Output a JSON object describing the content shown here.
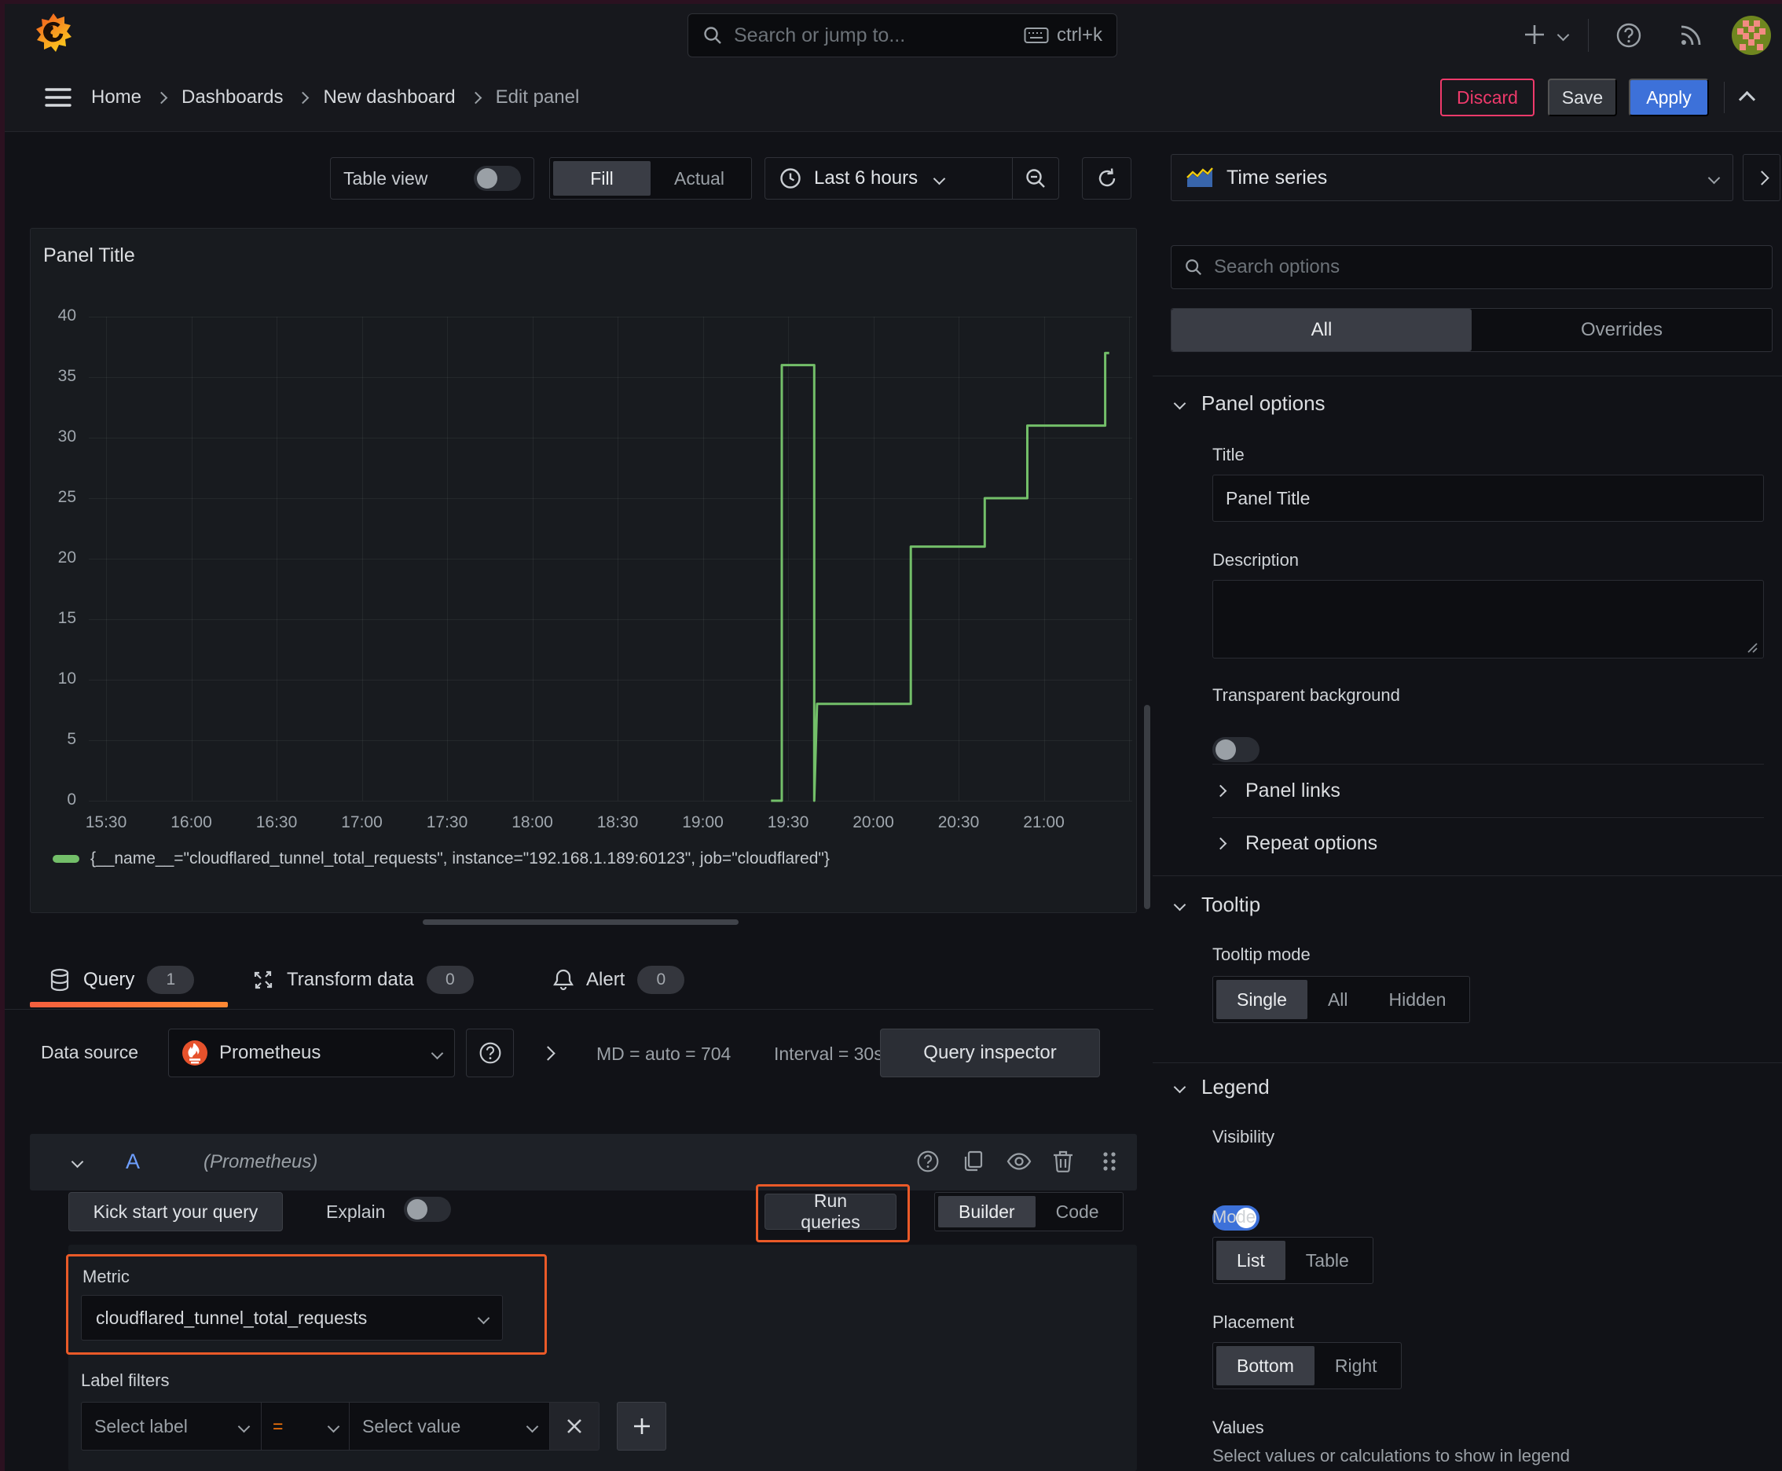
{
  "topnav": {
    "search_placeholder": "Search or jump to...",
    "shortcut": "ctrl+k"
  },
  "breadcrumb": {
    "items": [
      "Home",
      "Dashboards",
      "New dashboard",
      "Edit panel"
    ]
  },
  "actions": {
    "discard": "Discard",
    "save": "Save",
    "apply": "Apply"
  },
  "toolbar": {
    "table_view": "Table view",
    "fill": "Fill",
    "actual": "Actual",
    "time_range": "Last 6 hours"
  },
  "panel": {
    "title": "Panel Title"
  },
  "chart_data": {
    "type": "line",
    "line_style": "step",
    "title": "Panel Title",
    "grid": true,
    "legend_position": "bottom",
    "ylim": [
      0,
      40
    ],
    "y_ticks": [
      0,
      5,
      10,
      15,
      20,
      25,
      30,
      35,
      40
    ],
    "x_ticks": [
      {
        "t": 0,
        "label": "15:30"
      },
      {
        "t": 30,
        "label": "16:00"
      },
      {
        "t": 60,
        "label": "16:30"
      },
      {
        "t": 90,
        "label": "17:00"
      },
      {
        "t": 120,
        "label": "17:30"
      },
      {
        "t": 150,
        "label": "18:00"
      },
      {
        "t": 180,
        "label": "18:30"
      },
      {
        "t": 210,
        "label": "19:00"
      },
      {
        "t": 240,
        "label": "19:30"
      },
      {
        "t": 270,
        "label": "20:00"
      },
      {
        "t": 300,
        "label": "20:30"
      },
      {
        "t": 330,
        "label": "21:00"
      }
    ],
    "x_unit": "minutes after 15:30",
    "series": [
      {
        "name": "{__name__=\"cloudflared_tunnel_total_requests\", instance=\"192.168.1.189:60123\", job=\"cloudflared\"}",
        "color": "#73bf69",
        "points": [
          [
            234,
            0
          ],
          [
            237.8,
            0
          ],
          [
            237.8,
            36
          ],
          [
            249.2,
            36
          ],
          [
            249.2,
            0
          ],
          [
            250.2,
            8
          ],
          [
            283.2,
            8
          ],
          [
            283.2,
            21
          ],
          [
            309.2,
            21
          ],
          [
            309.2,
            25
          ],
          [
            324.2,
            25
          ],
          [
            324.2,
            31
          ],
          [
            351.6,
            31
          ],
          [
            351.6,
            37
          ],
          [
            353,
            37
          ]
        ]
      }
    ]
  },
  "tabs": {
    "query": "Query",
    "query_count": "1",
    "transform": "Transform data",
    "transform_count": "0",
    "alert": "Alert",
    "alert_count": "0"
  },
  "datasource_row": {
    "label": "Data source",
    "value": "Prometheus",
    "stats": "MD = auto = 704",
    "interval": "Interval = 30s",
    "inspector": "Query inspector"
  },
  "query_editor": {
    "ref_id": "A",
    "ds_hint": "(Prometheus)",
    "kick_start": "Kick start your query",
    "explain": "Explain",
    "run_queries": "Run queries",
    "builder": "Builder",
    "code": "Code",
    "metric_label": "Metric",
    "metric_value": "cloudflared_tunnel_total_requests",
    "label_filters": "Label filters",
    "select_label": "Select label",
    "operator": "=",
    "select_value": "Select value"
  },
  "sidebar": {
    "visualization": "Time series",
    "search_placeholder": "Search options",
    "tab_all": "All",
    "tab_overrides": "Overrides",
    "panel_options": {
      "title": "Panel options",
      "title_label": "Title",
      "title_value": "Panel Title",
      "description_label": "Description",
      "transparent_label": "Transparent background"
    },
    "links": "Panel links",
    "repeat": "Repeat options",
    "tooltip": {
      "title": "Tooltip",
      "mode_label": "Tooltip mode",
      "options": [
        "Single",
        "All",
        "Hidden"
      ]
    },
    "legend": {
      "title": "Legend",
      "visibility": "Visibility",
      "mode_label": "Mode",
      "mode_options": [
        "List",
        "Table"
      ],
      "placement_label": "Placement",
      "placement_options": [
        "Bottom",
        "Right"
      ],
      "values_label": "Values",
      "values_desc": "Select values or calculations to show in legend"
    }
  },
  "colors": {
    "background": "#111217",
    "panel": "#181b1f",
    "accent_blue": "#3d71d9",
    "series_green": "#73bf69",
    "highlight_orange": "#ea5a28",
    "danger_pink": "#ef3a6b",
    "prometheus_orange": "#e6522c",
    "tab_underline": [
      "#f55f3e",
      "#ff8833"
    ]
  }
}
